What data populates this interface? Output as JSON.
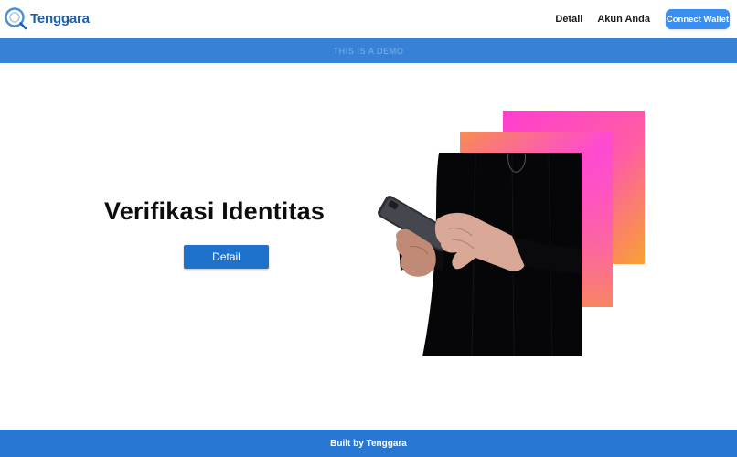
{
  "header": {
    "brand": "Tenggara",
    "logo_icon": "magnifier-logo-icon",
    "nav": [
      {
        "label": "Detail"
      },
      {
        "label": "Akun Anda"
      }
    ],
    "connect_label": "Connect Wallet"
  },
  "banner": {
    "text": "THIS IS A DEMO"
  },
  "hero": {
    "title": "Verifikasi Identitas",
    "button_label": "Detail",
    "image_icon": "hand-holding-phone-illustration"
  },
  "footer": {
    "text": "Built by Tenggara"
  },
  "colors": {
    "accent": "#3a8ef0",
    "banner": "#3782d6",
    "button": "#1e72cc",
    "footer": "#2878d3",
    "gradient_back": [
      "#ff45c8",
      "#f6a03a"
    ],
    "gradient_mid": [
      "#f88c4f",
      "#ff48d2"
    ]
  }
}
